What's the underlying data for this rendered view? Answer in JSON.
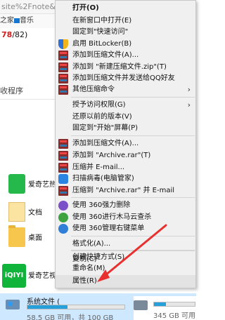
{
  "background": {
    "url_fragment": "site%2Fnote&edi",
    "fav_a": "之家",
    "fav_b": "音乐",
    "count_red": "78",
    "count_rest": "/82)",
    "column_header": "收程序",
    "items": [
      "爱奇艺热",
      "文档",
      "桌面"
    ],
    "iqiyi_logo": "iQIYI",
    "iqiyi_label": "爱奇艺视频",
    "drive": {
      "name": "系统文件 (",
      "free": "58.5 GB 可用，共 100 GB",
      "used_fraction": 0.415
    },
    "drive2": {
      "free": "345 GB 可用",
      "used_fraction": 0.3
    }
  },
  "context_menu": {
    "items": [
      {
        "label": "打开(O)",
        "bold": true
      },
      {
        "label": "在新窗口中打开(E)"
      },
      {
        "label": "固定到\"快速访问\""
      },
      {
        "label": "启用 BitLocker(B)",
        "icon": "shield-icon"
      },
      {
        "label": "添加到压缩文件(A)...",
        "icon": "winrar-icon"
      },
      {
        "label": "添加到 \"新建压缩文件.zip\"(T)",
        "icon": "winrar-icon"
      },
      {
        "label": "添加到压缩文件并发送给QQ好友",
        "icon": "winrar-icon"
      },
      {
        "label": "其他压缩命令",
        "icon": "winrar-icon",
        "submenu": true
      },
      {
        "label": "授予访问权限(G)",
        "submenu": true
      },
      {
        "label": "还原以前的版本(V)"
      },
      {
        "label": "固定到\"开始\"屏幕(P)"
      },
      {
        "label": "添加到压缩文件(A)...",
        "icon": "winrar-icon"
      },
      {
        "label": "添加到 \"Archive.rar\"(T)",
        "icon": "winrar-icon"
      },
      {
        "label": "压缩并 E-mail...",
        "icon": "winrar-icon"
      },
      {
        "label": "扫描病毒(电脑管家)",
        "icon": "tencent-shield-icon"
      },
      {
        "label": "压缩到 \"Archive.rar\" 并 E-mail",
        "icon": "winrar-icon"
      },
      {
        "label": "使用 360强力删除",
        "icon": "360-delete-icon"
      },
      {
        "label": "使用 360进行木马云查杀",
        "icon": "360-scan-icon"
      },
      {
        "label": "使用 360管理右键菜单",
        "icon": "360-menu-icon"
      },
      {
        "label": "格式化(A)..."
      },
      {
        "label": "复制(C)"
      },
      {
        "label": "创建快捷方式(S)"
      },
      {
        "label": "重命名(M)"
      },
      {
        "label": "属性(R)",
        "highlighted": true
      }
    ]
  },
  "colors": {
    "highlight": "#e3e3e3",
    "annotation": "#e8312f",
    "menu_bg": "#f0f0f0"
  }
}
